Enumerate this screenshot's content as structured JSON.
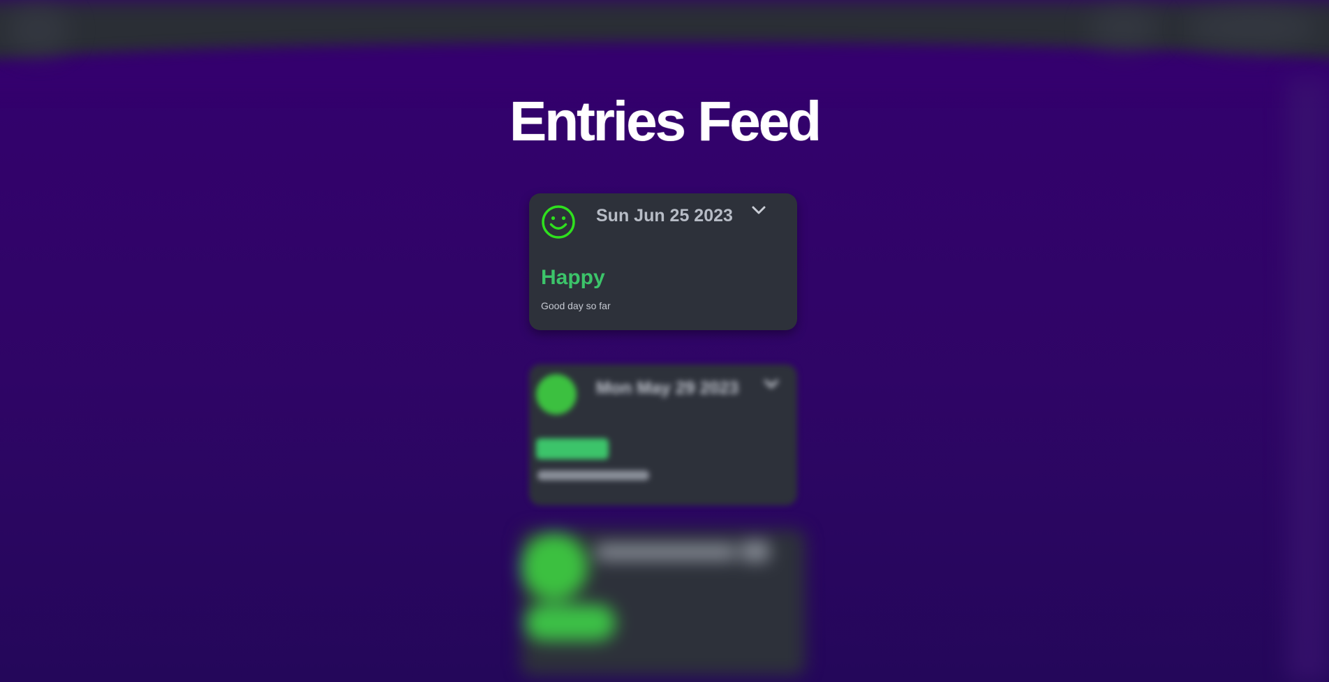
{
  "page": {
    "title": "Entries Feed"
  },
  "colors": {
    "background": "#34006e",
    "card": "#2d313a",
    "accent_green": "#3cc46a",
    "icon_green": "#2fe01e",
    "date_text": "#b7bcc6"
  },
  "entries": [
    {
      "date": "Sun Jun 25 2023",
      "mood": "Happy",
      "note": "Good day so far",
      "icon": "smiley-face-icon",
      "expand_icon": "chevron-down-icon"
    },
    {
      "date": "Mon May 29 2023",
      "icon": "smiley-face-icon",
      "expand_icon": "chevron-down-icon"
    }
  ]
}
